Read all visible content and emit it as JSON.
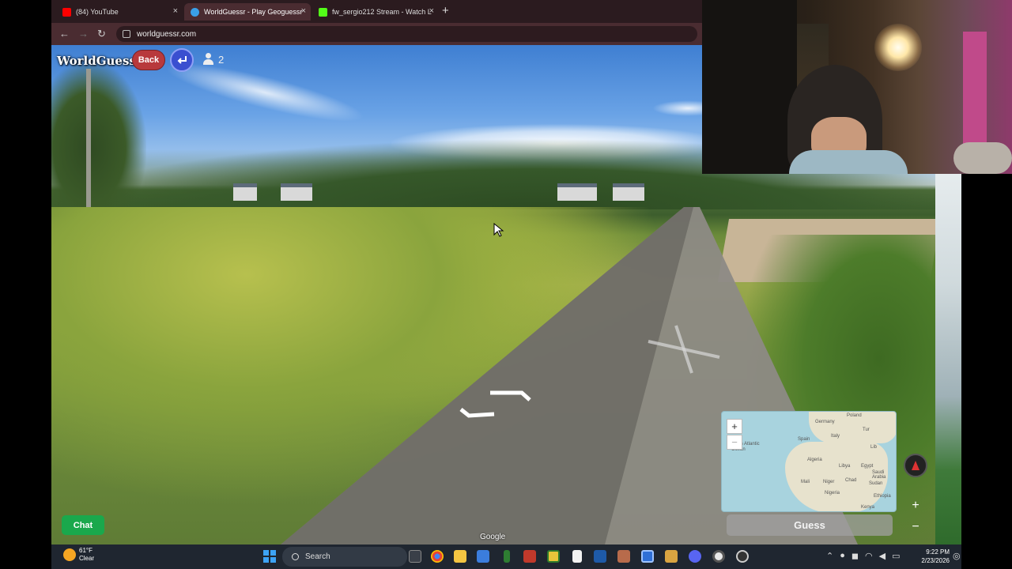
{
  "browser": {
    "tabs": [
      {
        "title": "(84) YouTube",
        "favicon_color": "#ff0000",
        "active": false
      },
      {
        "title": "WorldGuessr - Play Geoguessr",
        "favicon_color": "#3aa0e8",
        "active": true
      },
      {
        "title": "fw_sergio212 Stream - Watch L",
        "favicon_color": "#53fc18",
        "active": false
      }
    ],
    "new_tab_label": "+",
    "close_label": "×",
    "url": "worldguessr.com"
  },
  "game": {
    "logo": "WorldGuessr",
    "back_label": "Back",
    "player_count": "2",
    "chat_label": "Chat",
    "guess_label": "Guess",
    "map_zoom_in": "+",
    "map_zoom_out": "−",
    "sv_zoom_in": "+",
    "sv_zoom_out": "−",
    "google_attribution": "Google",
    "minimap_labels": [
      "Germany",
      "Poland",
      "Spain",
      "Italy",
      "Tur",
      "Lib",
      "North Atlantic Ocean",
      "Algeria",
      "Libya",
      "Egypt",
      "Mali",
      "Niger",
      "Chad",
      "Sudan",
      "Saudi Arabia",
      "Nigeria",
      "Ethiopia",
      "Kenya"
    ]
  },
  "taskbar": {
    "weather_temp": "61°F",
    "weather_desc": "Clear",
    "search_label": "Search",
    "time": "9:22 PM",
    "date": "2/23/2026"
  },
  "colors": {
    "back": "#b8393c",
    "undo": "#3a4fd0",
    "chat": "#1aa84c",
    "taskbar": "#1f2630"
  }
}
